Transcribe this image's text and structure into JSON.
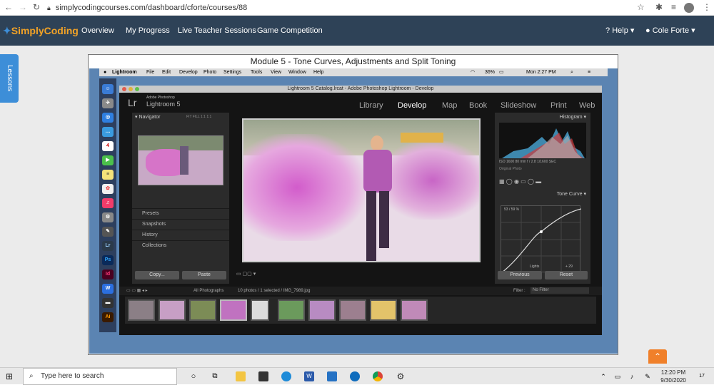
{
  "browser": {
    "url": "simplycodingcourses.com/dashboard/cforte/courses/88"
  },
  "site": {
    "logo": "SimplyCoding",
    "nav": [
      "Overview",
      "My Progress",
      "Live Teacher Sessions",
      "Game Competition"
    ],
    "help": "Help",
    "user": "Cole Forte",
    "lessons_tab": "Lessons"
  },
  "module": {
    "title": "Module 5 - Tone Curves, Adjustments and Split Toning"
  },
  "mac_menubar": {
    "items": [
      "Lightroom",
      "File",
      "Edit",
      "Develop",
      "Photo",
      "Settings",
      "Tools",
      "View",
      "Window",
      "Help"
    ],
    "battery": "36%",
    "clock": "Mon 2:27 PM"
  },
  "lightroom": {
    "window_title": "Lightroom 5 Catalog.lrcat - Adobe Photoshop Lightroom - Develop",
    "logo_lr": "Lr",
    "logo_sub": "Adobe Photoshop",
    "logo_name": "Lightroom 5",
    "modules": [
      "Library",
      "Develop",
      "Map",
      "Book",
      "Slideshow",
      "Print",
      "Web"
    ],
    "active_module": "Develop",
    "navigator": {
      "title": "Navigator",
      "fit_fill": "FIT  FILL  1:1  1:1"
    },
    "left_panels": [
      "Presets",
      "Snapshots",
      "History",
      "Collections"
    ],
    "copy_btn": "Copy...",
    "paste_btn": "Paste",
    "histogram": {
      "title": "Histogram",
      "info": "ISO 1600    80 mm    f / 2.8    1/1600 SEC",
      "original": "Original Photo"
    },
    "tone_curve": {
      "title": "Tone Curve",
      "readout": "53 / 59 %",
      "lights": "Lights",
      "lights_val": "+ 29"
    },
    "previous_btn": "Previous",
    "reset_btn": "Reset",
    "filmstrip": {
      "source": "All Photographs",
      "selection": "10 photos / 1 selected / IMG_7989.jpg",
      "filter_label": "Filter :",
      "filter_value": "No Filter"
    }
  },
  "taskbar": {
    "search_placeholder": "Type here to search",
    "time": "12:20 PM",
    "date": "9/30/2020",
    "notification_count": "17"
  },
  "colors": {
    "site_nav": "#2e4257",
    "accent_orange": "#f3a326",
    "lessons_blue": "#3d8ed8"
  }
}
